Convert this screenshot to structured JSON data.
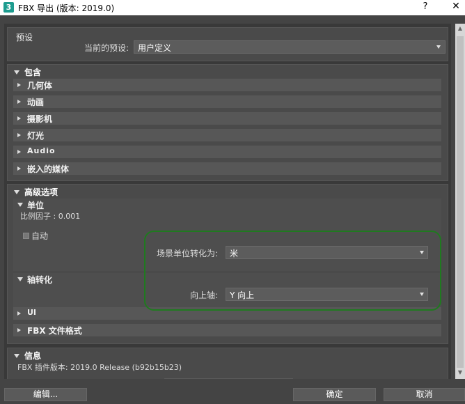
{
  "window": {
    "app_icon": "3",
    "title": "FBX 导出 (版本: 2019.0)",
    "help": "?",
    "close": "✕"
  },
  "presets": {
    "title": "预设",
    "label": "当前的预设:",
    "value": "用户定义"
  },
  "include": {
    "title": "包含",
    "items": [
      "几何体",
      "动画",
      "摄影机",
      "灯光",
      "Audio",
      "嵌入的媒体"
    ]
  },
  "advanced": {
    "title": "高级选项",
    "units": {
      "title": "单位",
      "scale_factor": "比例因子 : 0.001",
      "automatic": "自动",
      "scene_units_label": "场景单位转化为:",
      "scene_units_value": "米"
    },
    "axis": {
      "title": "轴转化",
      "up_axis_label": "向上轴:",
      "up_axis_value": "Y 向上"
    },
    "ui": "UI",
    "fbx_format": "FBX 文件格式"
  },
  "info": {
    "title": "信息",
    "plugin_version": "FBX 插件版本: 2019.0 Release (b92b15b23)"
  },
  "buttons": {
    "edit": "编辑...",
    "ok": "确定",
    "cancel": "取消"
  },
  "colors": {
    "background": "#444444",
    "highlight_outline": "#1f7a1f",
    "app_icon": "#1d9c8f"
  },
  "icons": {
    "app": "3dsmax-icon",
    "expand": "triangle-down-icon",
    "collapse": "triangle-right-icon",
    "dropdown": "chevron-down-icon"
  }
}
